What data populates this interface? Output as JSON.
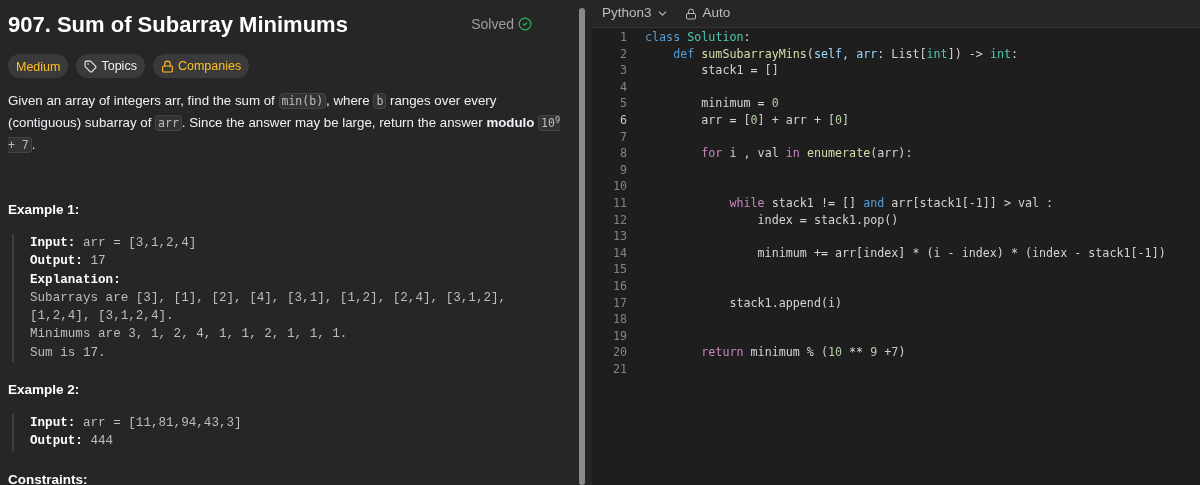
{
  "problem": {
    "title": "907. Sum of Subarray Minimums",
    "status": "Solved",
    "solved": true,
    "tags": [
      {
        "kind": "difficulty",
        "label": "Medium"
      },
      {
        "kind": "topics",
        "label": "Topics"
      },
      {
        "kind": "companies",
        "label": "Companies"
      }
    ],
    "description": [
      {
        "kind": "text",
        "text": "Given an array of integers arr, find the sum of "
      },
      {
        "kind": "code",
        "text": "min(b)"
      },
      {
        "kind": "text",
        "text": ", where "
      },
      {
        "kind": "code",
        "text": "b"
      },
      {
        "kind": "text",
        "text": " ranges over every (contiguous) subarray of "
      },
      {
        "kind": "code",
        "text": "arr"
      },
      {
        "kind": "text",
        "text": ". Since the answer may be large, return the answer **modulo** "
      },
      {
        "kind": "code",
        "text": "10$^{9}$ + 7"
      },
      {
        "kind": "text",
        "text": "."
      }
    ],
    "examples": [
      {
        "title": "Example 1:",
        "fields": [
          {
            "label": "Input:",
            "value": "arr = [3,1,2,4]"
          },
          {
            "label": "Output:",
            "value": "17"
          },
          {
            "label": "Explanation:"
          }
        ],
        "notes": [
          "Subarrays are [3], [1], [2], [4], [3,1], [1,2], [2,4], [3,1,2],",
          "[1,2,4], [3,1,2,4].",
          "Minimums are 3, 1, 2, 4, 1, 1, 2, 1, 1, 1.",
          "Sum is 17."
        ]
      },
      {
        "title": "Example 2:",
        "fields": [
          {
            "label": "Input:",
            "value": "arr = [11,81,94,43,3]"
          },
          {
            "label": "Output:",
            "value": "444"
          }
        ]
      }
    ],
    "next_heading": "Constraints:"
  },
  "editor": {
    "language": "Python3",
    "mode": "Auto",
    "lines": [
      {
        "number": "1",
        "current": false,
        "tokens": [
          {
            "kind": "keyword",
            "text": "class "
          },
          {
            "kind": "type",
            "text": "Solution"
          },
          {
            "kind": "plain",
            "text": ":"
          }
        ]
      },
      {
        "number": "2",
        "current": false,
        "tokens": [
          {
            "kind": "keyword",
            "text": "    def "
          },
          {
            "kind": "function",
            "text": "sumSubarrayMins"
          },
          {
            "kind": "plain",
            "text": "("
          },
          {
            "kind": "param",
            "text": "self"
          },
          {
            "kind": "plain",
            "text": ", "
          },
          {
            "kind": "param",
            "text": "arr"
          },
          {
            "kind": "plain",
            "text": ": List["
          },
          {
            "kind": "type",
            "text": "int"
          },
          {
            "kind": "plain",
            "text": "]) -> "
          },
          {
            "kind": "type",
            "text": "int"
          },
          {
            "kind": "plain",
            "text": ":"
          }
        ]
      },
      {
        "number": "3",
        "current": false,
        "tokens": [
          {
            "kind": "plain",
            "text": "        stack1 = []"
          }
        ]
      },
      {
        "number": "4",
        "current": false
      },
      {
        "number": "5",
        "current": false,
        "tokens": [
          {
            "kind": "plain",
            "text": "        minimum = "
          },
          {
            "kind": "number",
            "text": "0"
          }
        ]
      },
      {
        "number": "6",
        "current": true,
        "tokens": [
          {
            "kind": "plain",
            "text": "        arr = ["
          },
          {
            "kind": "number",
            "text": "0"
          },
          {
            "kind": "plain",
            "text": "] + arr + ["
          },
          {
            "kind": "number",
            "text": "0"
          },
          {
            "kind": "plain",
            "text": "]"
          }
        ]
      },
      {
        "number": "7",
        "current": false
      },
      {
        "number": "8",
        "current": false,
        "tokens": [
          {
            "kind": "control",
            "text": "        for"
          },
          {
            "kind": "plain",
            "text": " i , val "
          },
          {
            "kind": "control",
            "text": "in "
          },
          {
            "kind": "function",
            "text": "enumerate"
          },
          {
            "kind": "plain",
            "text": "(arr):"
          }
        ]
      },
      {
        "number": "9",
        "current": false
      },
      {
        "number": "10",
        "current": false
      },
      {
        "number": "11",
        "current": false,
        "tokens": [
          {
            "kind": "control",
            "text": "            while"
          },
          {
            "kind": "plain",
            "text": " stack1 != [] "
          },
          {
            "kind": "keyword",
            "text": "and"
          },
          {
            "kind": "plain",
            "text": " arr[stack1[-1]] > val :"
          }
        ]
      },
      {
        "number": "12",
        "current": false,
        "tokens": [
          {
            "kind": "plain",
            "text": "                index = stack1.pop()"
          }
        ]
      },
      {
        "number": "13",
        "current": false
      },
      {
        "number": "14",
        "current": false,
        "tokens": [
          {
            "kind": "plain",
            "text": "                minimum += arr[index] * (i - index) * (index - stack1[-1])"
          }
        ]
      },
      {
        "number": "15",
        "current": false
      },
      {
        "number": "16",
        "current": false
      },
      {
        "number": "17",
        "current": false,
        "tokens": [
          {
            "kind": "plain",
            "text": "            stack1.append(i)"
          }
        ]
      },
      {
        "number": "18",
        "current": false
      },
      {
        "number": "19",
        "current": false
      },
      {
        "number": "20",
        "current": false,
        "tokens": [
          {
            "kind": "control",
            "text": "        return"
          },
          {
            "kind": "plain",
            "text": " minimum % ("
          },
          {
            "kind": "number",
            "text": "10"
          },
          {
            "kind": "plain",
            "text": " ** "
          },
          {
            "kind": "number",
            "text": "9"
          },
          {
            "kind": "plain",
            "text": " +"
          },
          {
            "kind": "number",
            "text": "7"
          },
          {
            "kind": "plain",
            "text": ")"
          }
        ]
      },
      {
        "number": "21",
        "current": false
      }
    ]
  }
}
